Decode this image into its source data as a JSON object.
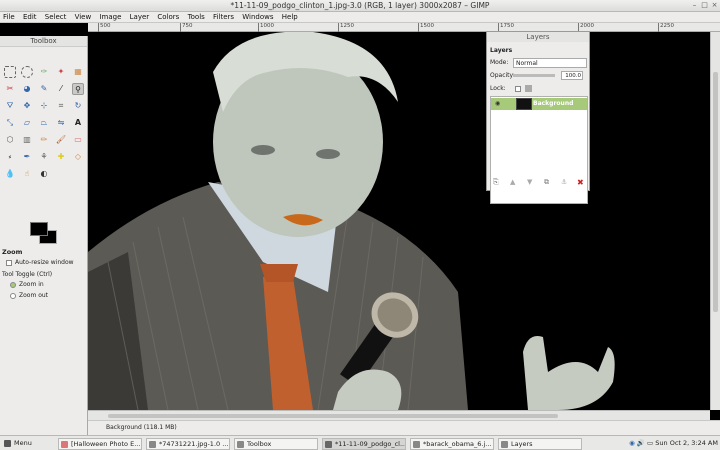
{
  "window": {
    "title": "*11-11-09_podgo_clinton_1.jpg-3.0 (RGB, 1 layer) 3000x2087 – GIMP"
  },
  "menubar": {
    "items": [
      "File",
      "Edit",
      "Select",
      "View",
      "Image",
      "Layer",
      "Colors",
      "Tools",
      "Filters",
      "Windows",
      "Help"
    ]
  },
  "ruler": {
    "ticks": [
      "500",
      "750",
      "1000",
      "1250",
      "1500",
      "1750",
      "2000",
      "2250"
    ]
  },
  "toolbox": {
    "title": "Toolbox",
    "tools": [
      "rect-select",
      "ellipse-select",
      "free-select",
      "fuzzy-select",
      "select-by-color",
      "scissors",
      "foreground-select",
      "paths",
      "color-picker",
      "zoom",
      "measure",
      "move",
      "align",
      "crop",
      "rotate",
      "scale",
      "shear",
      "perspective",
      "flip",
      "cage",
      "text",
      "bucket-fill",
      "blend",
      "pencil",
      "paintbrush",
      "eraser",
      "airbrush",
      "ink",
      "clone",
      "heal",
      "perspective-clone",
      "blur",
      "smudge",
      "dodge"
    ],
    "options": {
      "title": "Zoom",
      "auto_resize": "Auto-resize window",
      "toggle_label": "Tool Toggle  (Ctrl)",
      "zoom_in": "Zoom in",
      "zoom_out": "Zoom out"
    }
  },
  "layers": {
    "title": "Layers",
    "tab": "Layers",
    "mode_label": "Mode:",
    "mode_value": "Normal",
    "opacity_label": "Opacity:",
    "opacity_value": "100.0",
    "lock_label": "Lock:",
    "layer_name": "Background"
  },
  "status": {
    "text": "Background (118.1 MB)"
  },
  "taskbar": {
    "menu": "Menu",
    "tasks": [
      "[Halloween Photo E...",
      "*74731221.jpg-1.0 ...",
      "Toolbox",
      "*11-11-09_podgo_cl...",
      "*barack_obama_6.j...",
      "Layers"
    ],
    "clock": "Sun Oct  2,  3:24 AM"
  },
  "colors": {
    "accent": "#a7c97a",
    "canvas": "#000000",
    "fg": "#000000",
    "bg": "#000000"
  }
}
